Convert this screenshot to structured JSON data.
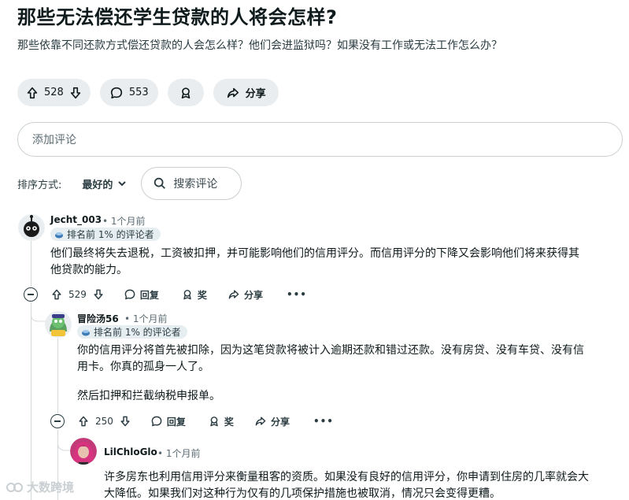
{
  "post": {
    "title": "那些无法偿还学生贷款的人将会怎样?",
    "body": "那些依靠不同还款方式偿还贷款的人会怎么样？他们会进监狱吗？如果没有工作或无法工作怎么办？",
    "upvotes": "528",
    "comments_count": "553",
    "share_label": "分享"
  },
  "comment_box": {
    "placeholder": "添加评论"
  },
  "sort": {
    "label": "排序方式:",
    "value": "最好的",
    "search_placeholder": "搜索评论"
  },
  "comments": [
    {
      "username": "Jecht_003",
      "time": "• 1个月前",
      "badge": "排名前 1% 的评论者",
      "lines": [
        "他们最终将失去退税，工资被扣押，并可能影响他们的信用评分。而信用评分的下降又会影响他们将来获得其",
        "他贷款的能力。"
      ],
      "votes": "529",
      "reply_label": "回复",
      "award_label": "奖",
      "share_label": "分享",
      "more_label": "•••"
    },
    {
      "username": "冒险汤56",
      "time": "• 1个月前",
      "badge": "排名前 1% 的评论者",
      "lines": [
        "你的信用评分将首先被扣除，因为这笔贷款将被计入逾期还款和错过还款。没有房贷、没有车贷、没有信",
        "用卡。你真的孤身一人了。",
        "然后扣押和拦截纳税申报单。"
      ],
      "votes": "250",
      "reply_label": "回复",
      "award_label": "奖",
      "share_label": "分享",
      "more_label": "•••"
    },
    {
      "username": "LilChloGlo",
      "time": "• 1个月前",
      "lines": [
        "许多房东也利用信用评分来衡量租客的资质。如果没有良好的信用评分，你申请到住房的几率就会大",
        "大降低。如果我们对这种行为仅有的几项保护措施也被取消，情况只会变得更糟。"
      ]
    }
  ],
  "watermark": "大数跨境",
  "colors": {
    "pill_bg": "#eaedef",
    "badge_bg": "#e6eef2",
    "thread_line": "#d4d9dc"
  }
}
